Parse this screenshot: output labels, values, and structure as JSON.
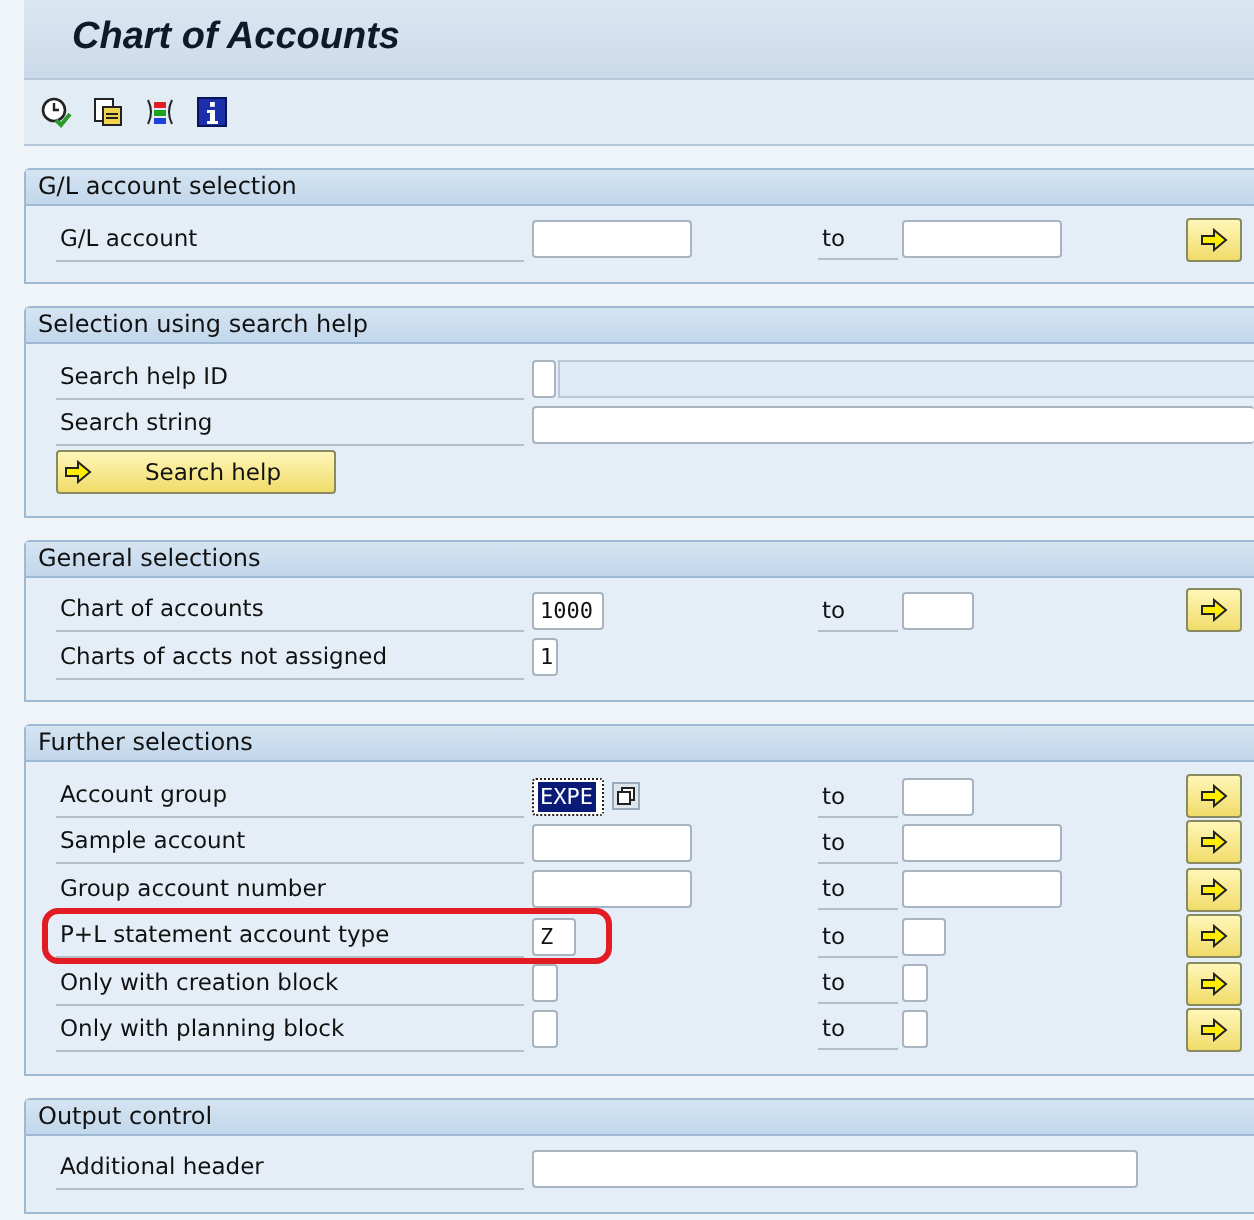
{
  "window": {
    "title": "Chart of Accounts"
  },
  "sections": [
    {
      "title": "G/L account selection",
      "rows": [
        {
          "kind": "range",
          "label": "G/L account",
          "highlighted": false,
          "from": {
            "selected": false
          },
          "to_label": "to"
        }
      ]
    },
    {
      "title": "Selection using search help",
      "rows": [
        {
          "kind": "search-id",
          "label": "Search help ID",
          "highlighted": false
        },
        {
          "kind": "text",
          "label": "Search string",
          "highlighted": false
        },
        {
          "kind": "button",
          "label": "Search help",
          "highlighted": false
        }
      ]
    },
    {
      "title": "General selections",
      "rows": [
        {
          "kind": "range",
          "label": "Chart of accounts",
          "highlighted": false,
          "from": {
            "value": "1000",
            "selected": false
          },
          "to_label": "to"
        },
        {
          "kind": "single",
          "label": "Charts of accts not assigned",
          "highlighted": false,
          "from": {
            "value": "1",
            "selected": false
          }
        }
      ]
    },
    {
      "title": "Further selections",
      "rows": [
        {
          "kind": "range",
          "label": "Account group",
          "highlighted": false,
          "from": {
            "value": "EXPE",
            "selected": true
          },
          "to_label": "to"
        },
        {
          "kind": "range",
          "label": "Sample account",
          "highlighted": false,
          "from": {
            "selected": false
          },
          "to_label": "to"
        },
        {
          "kind": "range",
          "label": "Group account number",
          "highlighted": false,
          "from": {
            "selected": false
          },
          "to_label": "to"
        },
        {
          "kind": "range",
          "label": "P+L statement account type",
          "highlighted": true,
          "from": {
            "value": "Z",
            "selected": false
          },
          "to_label": "to"
        },
        {
          "kind": "range",
          "label": "Only with creation block",
          "highlighted": false,
          "from": {
            "selected": false
          },
          "to_label": "to"
        },
        {
          "kind": "range",
          "label": "Only with planning block",
          "highlighted": false,
          "from": {
            "selected": false
          },
          "to_label": "to"
        }
      ]
    },
    {
      "title": "Output control",
      "rows": [
        {
          "kind": "text",
          "label": "Additional header",
          "highlighted": false
        }
      ]
    }
  ]
}
